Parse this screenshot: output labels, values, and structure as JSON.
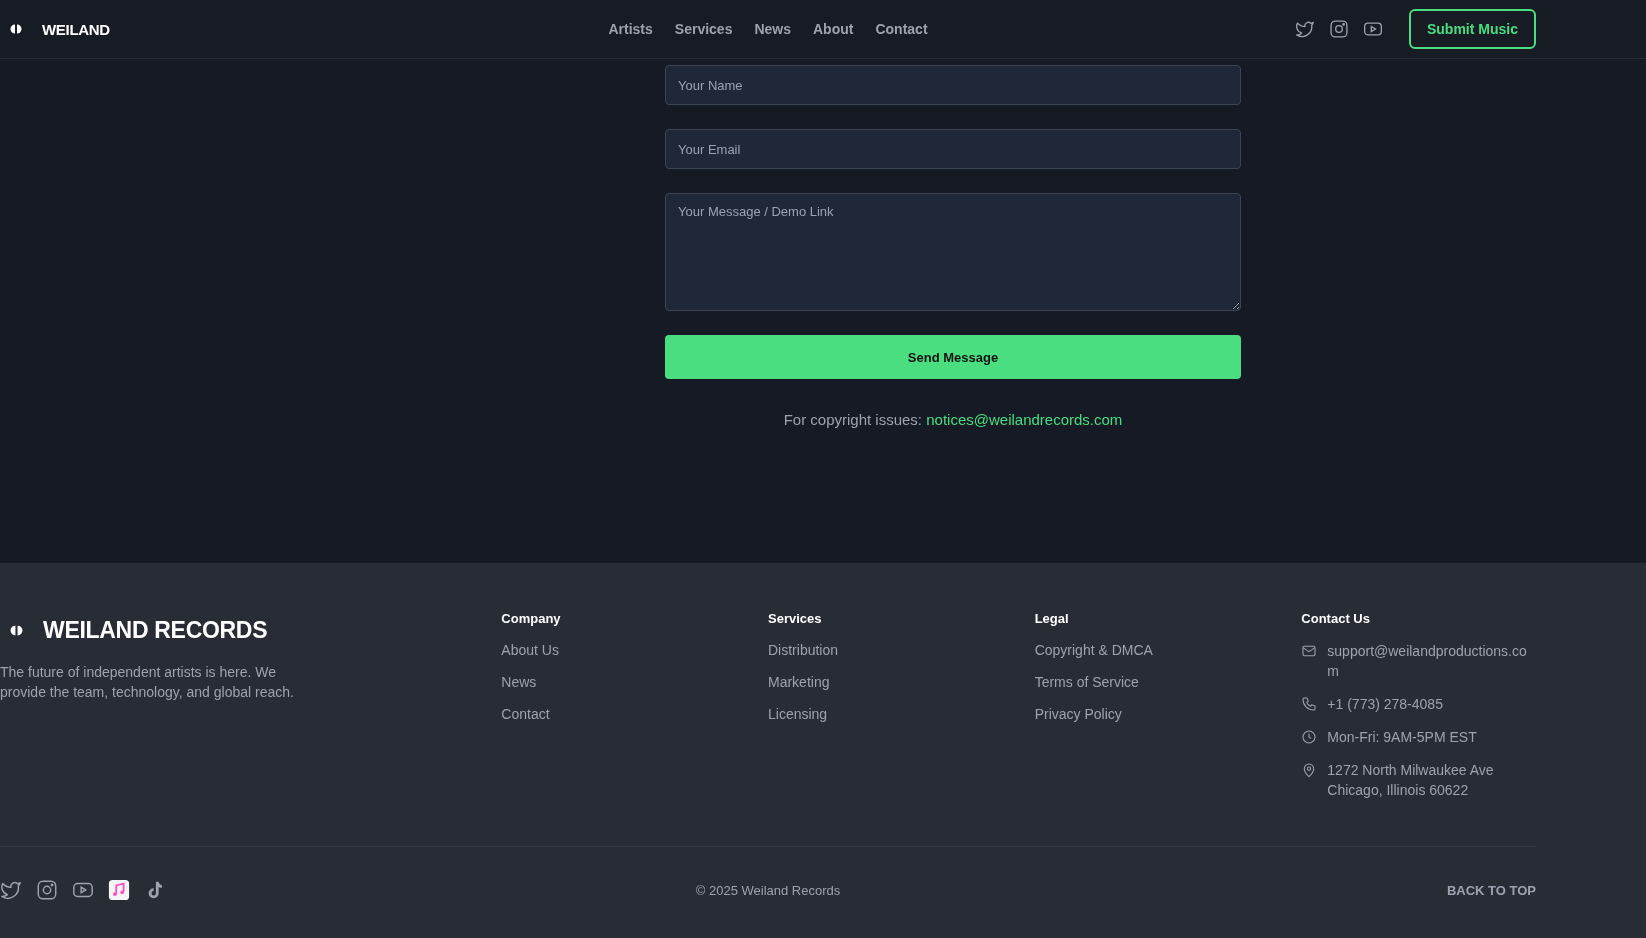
{
  "header": {
    "logo": "WEILAND",
    "nav": [
      "Artists",
      "Services",
      "News",
      "About",
      "Contact"
    ],
    "social": [
      {
        "kind": "twitter"
      },
      {
        "kind": "instagram"
      },
      {
        "kind": "youtube"
      }
    ],
    "submit_button": "Submit Music"
  },
  "form": {
    "name_placeholder": "Your Name",
    "email_placeholder": "Your Email",
    "message_placeholder": "Your Message / Demo Link",
    "send_button": "Send Message",
    "copyright_label": "For copyright issues:",
    "copyright_email": "notices@weilandrecords.com"
  },
  "footer": {
    "brand": "WEILAND RECORDS",
    "tagline": "The future of independent artists is here. We provide the team, technology, and global reach.",
    "columns": [
      {
        "title": "Company",
        "links": [
          "About Us",
          "News",
          "Contact"
        ]
      },
      {
        "title": "Services",
        "links": [
          "Distribution",
          "Marketing",
          "Licensing"
        ]
      },
      {
        "title": "Legal",
        "links": [
          "Copyright & DMCA",
          "Terms of Service",
          "Privacy Policy"
        ]
      }
    ],
    "contact": {
      "title": "Contact Us",
      "items": [
        {
          "kind": "email",
          "text": "support@weilandproductions.com"
        },
        {
          "kind": "phone",
          "text": "+1 (773) 278-4085"
        },
        {
          "kind": "hours",
          "text": "Mon-Fri: 9AM-5PM EST"
        },
        {
          "kind": "address",
          "text": "1272 North Milwaukee Ave Chicago, Illinois 60622"
        }
      ]
    },
    "social": [
      {
        "kind": "twitter"
      },
      {
        "kind": "instagram"
      },
      {
        "kind": "youtube"
      },
      {
        "kind": "music"
      },
      {
        "kind": "tiktok"
      }
    ],
    "copyright": "© 2025 Weiland Records",
    "back_to_top": "BACK TO TOP"
  }
}
